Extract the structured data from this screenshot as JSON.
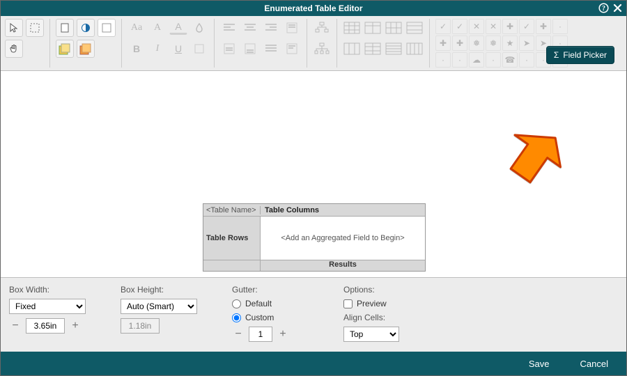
{
  "title": "Enumerated Table Editor",
  "fieldPicker": {
    "sigma": "Σ",
    "label": "Field Picker"
  },
  "symbols": {
    "row1": [
      "✓",
      "✓",
      "✕",
      "✕",
      "✚",
      "✓",
      "✚",
      "·"
    ],
    "row2": [
      "✚",
      "✚",
      "❅",
      "❅",
      "★",
      "➤",
      "➤",
      "·"
    ],
    "row3": [
      "·",
      "·",
      "☁",
      "·",
      "☎",
      "·",
      "·",
      "▾"
    ]
  },
  "etable": {
    "corner": "<Table Name>",
    "cols": "Table Columns",
    "rows": "Table Rows",
    "center": "<Add an Aggregated Field to Begin>",
    "results": "Results"
  },
  "props": {
    "boxWidthLabel": "Box Width:",
    "boxWidthMode": "Fixed",
    "boxWidthValue": "3.65in",
    "boxHeightLabel": "Box Height:",
    "boxHeightMode": "Auto (Smart)",
    "boxHeightValue": "1.18in",
    "gutterLabel": "Gutter:",
    "gutterDefault": "Default",
    "gutterCustom": "Custom",
    "gutterValue": "1",
    "optionsLabel": "Options:",
    "preview": "Preview",
    "alignLabel": "Align Cells:",
    "alignValue": "Top"
  },
  "footer": {
    "save": "Save",
    "cancel": "Cancel"
  }
}
